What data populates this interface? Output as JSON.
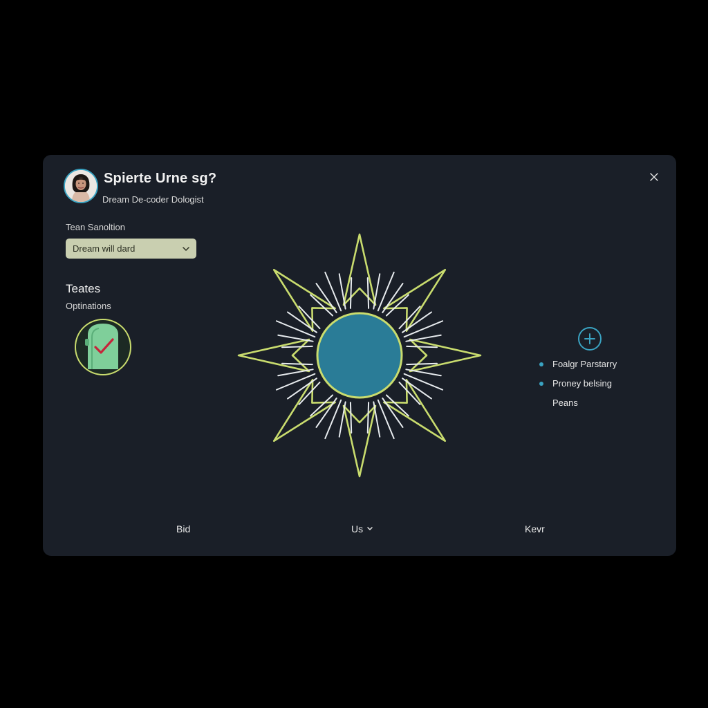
{
  "header": {
    "title": "Spierte Urne sg?",
    "subtitle": "Dream De-coder Dologist",
    "close_icon": "close-icon"
  },
  "form": {
    "label": "Tean Sanoltion",
    "select_value": "Dream will dard",
    "select_icon": "chevron-down-icon"
  },
  "section": {
    "title": "Teates",
    "subtitle": "Optinations",
    "badge_icon": "check-badge-icon"
  },
  "right": {
    "add_icon": "plus-circle-icon",
    "items": [
      "Foalgr Parstarry",
      "Proney belsing"
    ],
    "extra": "Peans"
  },
  "footer": {
    "left": "Bid",
    "center": "Us",
    "right": "Kevr"
  },
  "colors": {
    "background": "#000000",
    "panel": "#1a1f28",
    "accent": "#3aa3c2",
    "lime": "#c9dc6e",
    "select_bg": "#c9cfb0",
    "center_circle": "#2a7c97"
  }
}
